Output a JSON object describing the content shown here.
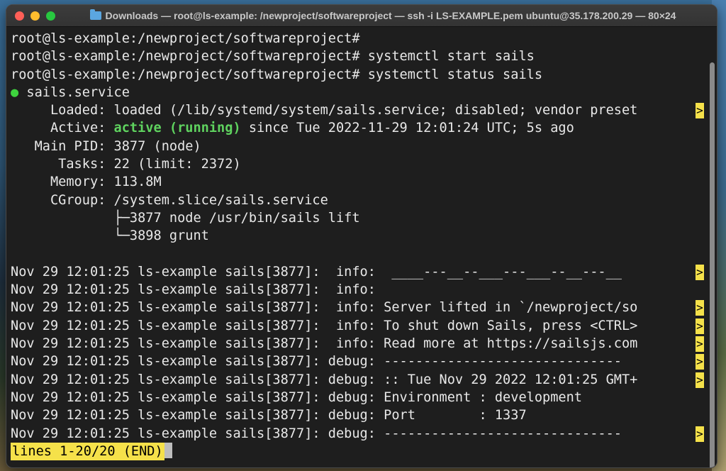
{
  "window": {
    "title": "Downloads — root@ls-example: /newproject/softwareproject — ssh -i LS-EXAMPLE.pem ubuntu@35.178.200.29 — 80×24"
  },
  "terminal": {
    "lines": [
      {
        "text": "root@ls-example:/newproject/softwareproject#"
      },
      {
        "text": "root@ls-example:/newproject/softwareproject# systemctl start sails"
      },
      {
        "text": "root@ls-example:/newproject/softwareproject# systemctl status sails"
      },
      {
        "dot": "●",
        "text": " sails.service"
      },
      {
        "text": "     Loaded: loaded (/lib/systemd/system/sails.service; disabled; vendor preset",
        "trunc": ">"
      },
      {
        "pre": "     Active: ",
        "green": "active (running)",
        "text": " since Tue 2022-11-29 12:01:24 UTC; 5s ago"
      },
      {
        "text": "   Main PID: 3877 (node)"
      },
      {
        "text": "      Tasks: 22 (limit: 2372)"
      },
      {
        "text": "     Memory: 113.8M"
      },
      {
        "text": "     CGroup: /system.slice/sails.service"
      },
      {
        "text": "             ├─3877 node /usr/bin/sails lift"
      },
      {
        "text": "             └─3898 grunt"
      },
      {
        "text": ""
      },
      {
        "text": "Nov 29 12:01:25 ls-example sails[3877]:  info:  ____---__--___---___--__---__",
        "trunc": ">"
      },
      {
        "text": "Nov 29 12:01:25 ls-example sails[3877]:  info:"
      },
      {
        "text": "Nov 29 12:01:25 ls-example sails[3877]:  info: Server lifted in `/newproject/so",
        "trunc": ">"
      },
      {
        "text": "Nov 29 12:01:25 ls-example sails[3877]:  info: To shut down Sails, press <CTRL>",
        "trunc": ">"
      },
      {
        "text": "Nov 29 12:01:25 ls-example sails[3877]:  info: Read more at https://sailsjs.com",
        "trunc": ">"
      },
      {
        "text": "Nov 29 12:01:25 ls-example sails[3877]: debug: ------------------------------",
        "trunc": ">"
      },
      {
        "text": "Nov 29 12:01:25 ls-example sails[3877]: debug: :: Tue Nov 29 2022 12:01:25 GMT+",
        "trunc": ">"
      },
      {
        "text": "Nov 29 12:01:25 ls-example sails[3877]: debug: Environment : development"
      },
      {
        "text": "Nov 29 12:01:25 ls-example sails[3877]: debug: Port        : 1337"
      },
      {
        "text": "Nov 29 12:01:25 ls-example sails[3877]: debug: ------------------------------",
        "trunc": ">"
      }
    ],
    "status_line": "lines 1-20/20 (END)"
  },
  "colors": {
    "status_bg": "#f5e14a",
    "active_green": "#5fd35f",
    "dot_green": "#3ed33e"
  }
}
